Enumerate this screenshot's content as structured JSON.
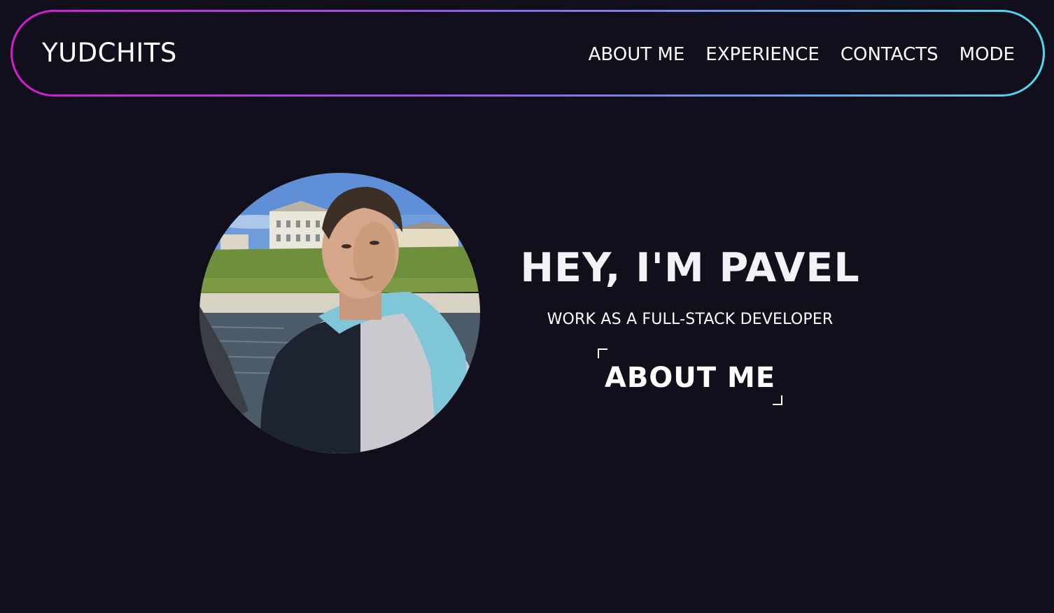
{
  "header": {
    "logo": "YUDCHITS",
    "nav": [
      {
        "label": "ABOUT ME"
      },
      {
        "label": "EXPERIENCE"
      },
      {
        "label": "CONTACTS"
      },
      {
        "label": "MODE"
      }
    ],
    "border_gradient": [
      "#d41ccf",
      "#8f5fe8",
      "#4fd8ee"
    ]
  },
  "hero": {
    "title": "HEY, I'M PAVEL",
    "subtitle": "WORK AS A FULL-STACK DEVELOPER",
    "cta_label": "ABOUT ME",
    "avatar_icon": "profile-photo"
  },
  "colors": {
    "background": "#110f1c",
    "text": "#ffffff"
  }
}
